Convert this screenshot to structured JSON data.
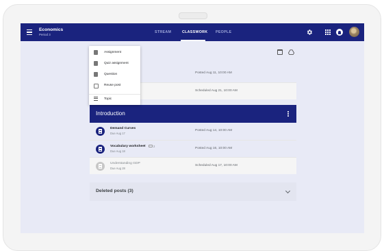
{
  "course": {
    "name": "Economics",
    "period": "Period 3"
  },
  "tabs": [
    {
      "label": "STREAM",
      "active": false
    },
    {
      "label": "CLASSWORK",
      "active": true
    },
    {
      "label": "PEOPLE",
      "active": false
    }
  ],
  "create_menu": [
    {
      "label": "Assignment",
      "icon": "assignment-icon"
    },
    {
      "label": "Quiz assignment",
      "icon": "quiz-icon"
    },
    {
      "label": "Question",
      "icon": "question-icon"
    },
    {
      "label": "Reuse post",
      "icon": "reuse-icon"
    },
    {
      "label": "Topic",
      "icon": "topic-icon"
    }
  ],
  "top_card": [
    {
      "date": "Posted Aug 11, 10:00 AM"
    },
    {
      "date": "Scheduled Aug 21, 10:00 AM"
    }
  ],
  "topic": {
    "title": "Introduction",
    "items": [
      {
        "title": "Demand Curves",
        "due": "Due Aug 17",
        "date": "Posted Aug 14, 10:00 AM",
        "attachments": ""
      },
      {
        "title": "Vocabulary worksheet",
        "due": "Due Aug 18",
        "date": "Posted Aug 16, 10:00 AM",
        "attachments": "2"
      },
      {
        "title": "Understanding GDP",
        "due": "Due Aug 28",
        "date": "Scheduled Aug 17, 10:00 AM",
        "attachments": ""
      }
    ]
  },
  "deleted_posts": "Deleted posts (3)",
  "colors": {
    "primary": "#1a237e",
    "background": "#e8eaf6"
  }
}
